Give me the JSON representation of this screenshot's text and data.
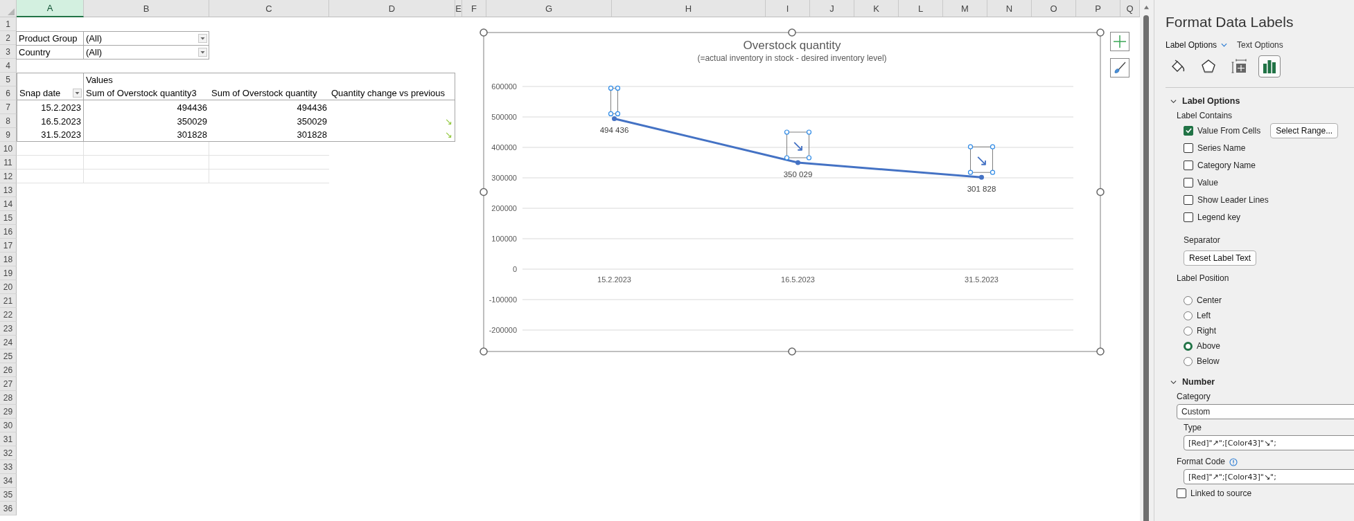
{
  "column_headers": [
    {
      "label": "A",
      "selected": true
    },
    {
      "label": "B",
      "selected": false
    },
    {
      "label": "C",
      "selected": false
    },
    {
      "label": "D",
      "selected": false
    },
    {
      "label": "E",
      "selected": false
    },
    {
      "label": "F",
      "selected": false
    },
    {
      "label": "G",
      "selected": false
    },
    {
      "label": "H",
      "selected": false
    },
    {
      "label": "I",
      "selected": false
    },
    {
      "label": "J",
      "selected": false
    },
    {
      "label": "K",
      "selected": false
    },
    {
      "label": "L",
      "selected": false
    },
    {
      "label": "M",
      "selected": false
    },
    {
      "label": "N",
      "selected": false
    },
    {
      "label": "O",
      "selected": false
    },
    {
      "label": "P",
      "selected": false
    },
    {
      "label": "Q",
      "selected": false
    }
  ],
  "row_numbers": [
    "1",
    "2",
    "3",
    "4",
    "5",
    "6",
    "7",
    "8",
    "9",
    "10",
    "11",
    "12",
    "13",
    "14",
    "15",
    "16",
    "17",
    "18",
    "19",
    "20",
    "21",
    "22",
    "23",
    "24",
    "25",
    "26",
    "27",
    "28",
    "29",
    "30",
    "31",
    "32",
    "33",
    "34",
    "35",
    "36"
  ],
  "pivot": {
    "filters": [
      {
        "field": "Product Group",
        "value": "(All)"
      },
      {
        "field": "Country",
        "value": "(All)"
      }
    ],
    "values_caption": "Values",
    "row_field": "Snap date",
    "columns": [
      "Sum of Overstock quantity3",
      "Sum of Overstock quantity",
      "Quantity change vs previous"
    ],
    "rows": [
      {
        "date": "15.2.2023",
        "values": [
          "494436",
          "494436"
        ]
      },
      {
        "date": "16.5.2023",
        "values": [
          "350029",
          "350029"
        ],
        "change": "↘"
      },
      {
        "date": "31.5.2023",
        "values": [
          "301828",
          "301828"
        ],
        "change": "↘"
      }
    ]
  },
  "chart": {
    "subtitle": "(=actual inventory in stock - desired inventory level)",
    "chart_data": {
      "type": "line",
      "title": "Overstock quantity",
      "categories": [
        "15.2.2023",
        "16.5.2023",
        "31.5.2023"
      ],
      "series": [
        {
          "color": "#4472c4",
          "marker": true,
          "values": [
            494436,
            350029,
            301828
          ]
        }
      ],
      "grid": true,
      "ylim": [
        -200000,
        600000
      ],
      "yticks": [
        -200000,
        -100000,
        0,
        100000,
        200000,
        300000,
        400000,
        500000,
        600000
      ],
      "value_labels": [
        "494 436",
        "350 029",
        "301 828"
      ]
    },
    "selected_labels": [
      {
        "kind": "empty"
      },
      {
        "kind": "text",
        "text": "↘"
      },
      {
        "kind": "text",
        "text": "↘"
      }
    ]
  },
  "panel": {
    "title": "Format Data Labels",
    "tabs": [
      {
        "label": "Label Options",
        "selected": true
      },
      {
        "label": "Text Options",
        "selected": false
      }
    ],
    "icon_tabs": [
      {
        "kind": "fill",
        "selected": false
      },
      {
        "kind": "effects",
        "selected": false
      },
      {
        "kind": "size",
        "selected": false
      },
      {
        "kind": "options",
        "selected": true
      }
    ],
    "label_options": {
      "heading": "Label Options",
      "expanded": true,
      "contains_caption": "Label Contains",
      "checkboxes": [
        {
          "label": "Value From Cells",
          "checked": true
        },
        {
          "label": "Series Name",
          "checked": false
        },
        {
          "label": "Category Name",
          "checked": false
        },
        {
          "label": "Value",
          "checked": false
        },
        {
          "label": "Show Leader Lines",
          "checked": false
        },
        {
          "label": "Legend key",
          "checked": false
        }
      ],
      "select_range_button": "Select Range...",
      "separator_caption": "Separator",
      "reset_button": "Reset Label Text",
      "position_caption": "Label Position",
      "positions": [
        {
          "label": "Center",
          "selected": false
        },
        {
          "label": "Left",
          "selected": false
        },
        {
          "label": "Right",
          "selected": false
        },
        {
          "label": "Above",
          "selected": true
        },
        {
          "label": "Below",
          "selected": false
        }
      ]
    },
    "number": {
      "heading": "Number",
      "expanded": true,
      "category_caption": "Category",
      "category": "Custom",
      "type_caption": "Type",
      "type": "[Red]\"↗\";[Color43]\"↘\";",
      "format_code_caption": "Format Code",
      "format_code": "[Red]\"↗\";[Color43]\"↘\";",
      "linked": {
        "label": "Linked to source",
        "checked": false
      }
    }
  }
}
